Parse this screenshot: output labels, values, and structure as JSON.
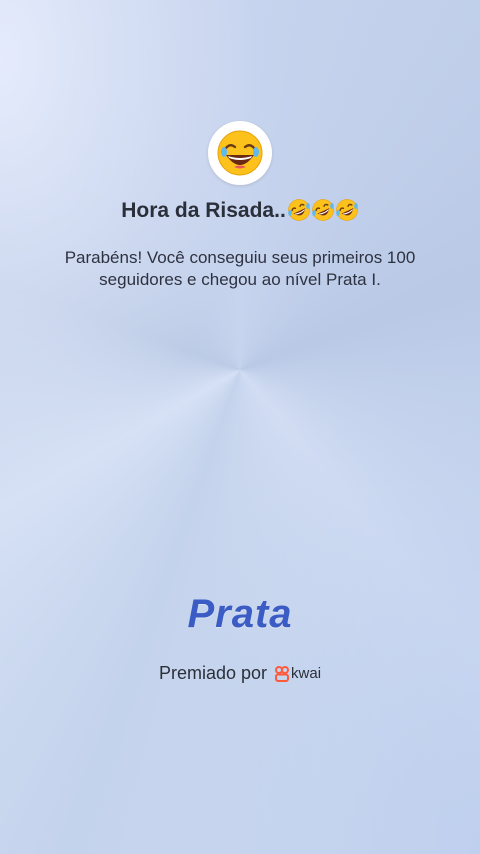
{
  "celebration": {
    "title": "Hora da Risada..",
    "title_emoji_count": 3,
    "avatar_icon": "laughing-face-icon",
    "title_emoji_icon": "rolling-on-floor-laughing-icon",
    "message": "Parabéns! Você conseguiu seus primeiros 100 seguidores e chegou ao nível Prata I.",
    "tier_name": "Prata",
    "awarded_by_label": "Premiado por",
    "brand_name": "kwai",
    "brand_icon": "kwai-logo-icon"
  },
  "colors": {
    "tier_text": "#3a5cc4",
    "brand_logo": "#ff5a3c",
    "background": "#c4d3ec"
  }
}
